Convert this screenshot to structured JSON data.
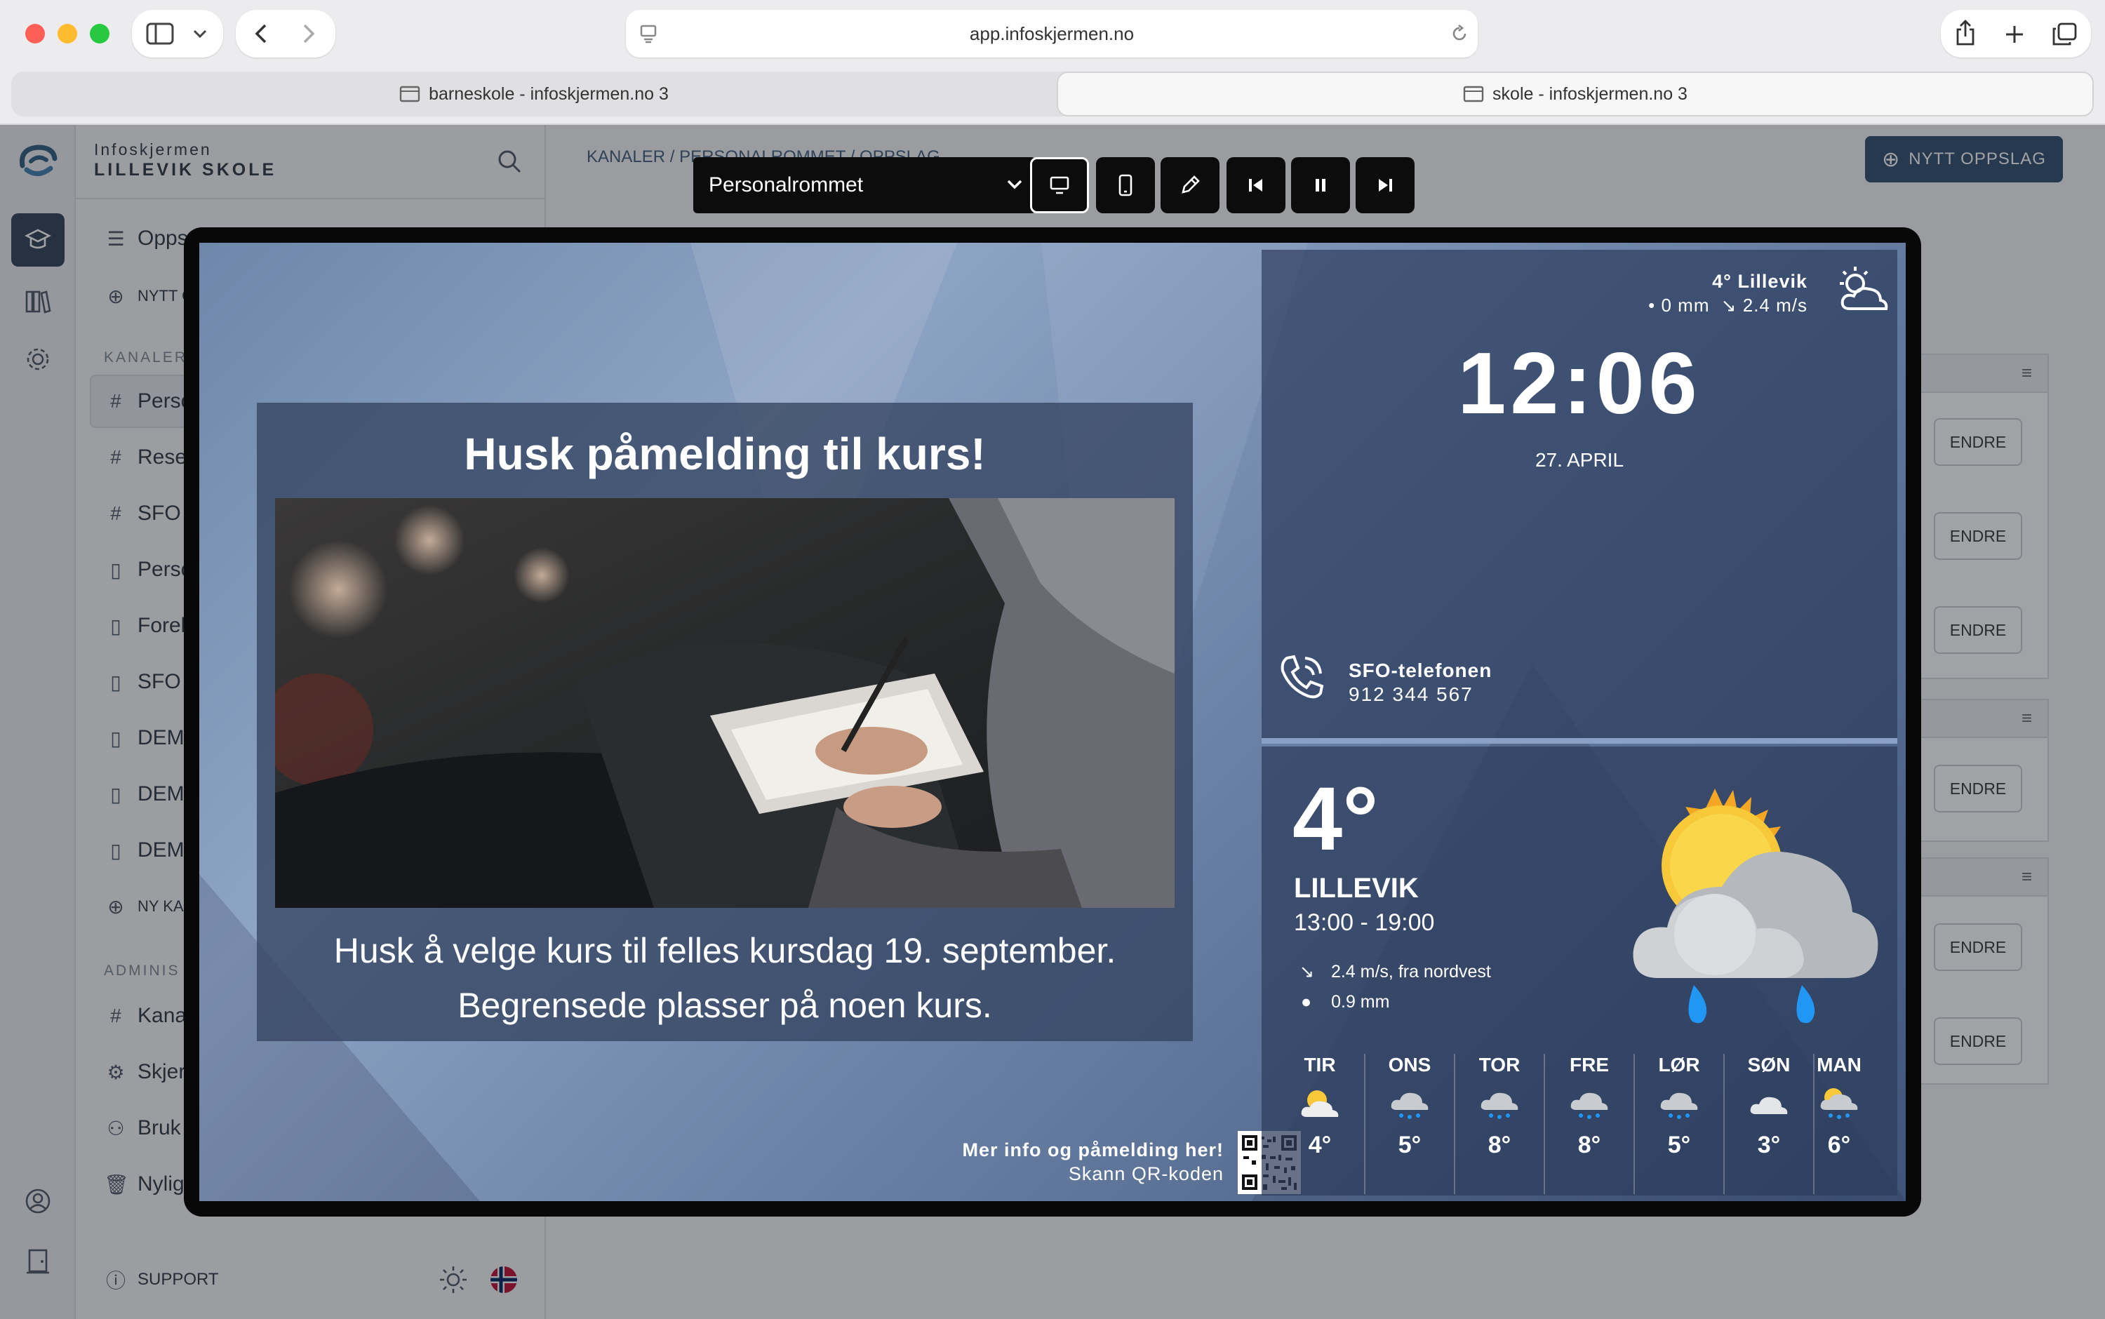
{
  "browser": {
    "url": "app.infoskjermen.no",
    "tabs": [
      {
        "label": "barneskole - infoskjermen.no 3"
      },
      {
        "label": "skole - infoskjermen.no 3"
      }
    ]
  },
  "brand": {
    "line1": "Infoskjermen",
    "line2": "LILLEVIK SKOLE"
  },
  "sidebar": {
    "items_top": [
      {
        "label": "Opps",
        "icon": "list-icon"
      },
      {
        "label": "NYTT O",
        "icon": "plus-circle-icon"
      }
    ],
    "section_kanaler": "KANALER",
    "kanaler": [
      {
        "label": "Perso",
        "icon": "hash-icon"
      },
      {
        "label": "Rese",
        "icon": "hash-icon"
      },
      {
        "label": "SFO",
        "icon": "hash-icon"
      },
      {
        "label": "Perso",
        "icon": "phone-icon"
      },
      {
        "label": "Forel",
        "icon": "phone-icon"
      },
      {
        "label": "SFO",
        "icon": "phone-icon"
      },
      {
        "label": "DEM",
        "icon": "phone-icon"
      },
      {
        "label": "DEM",
        "icon": "phone-icon"
      },
      {
        "label": "DEM",
        "icon": "phone-icon"
      },
      {
        "label": "NY KA",
        "icon": "plus-circle-icon"
      }
    ],
    "section_admin": "ADMINIS",
    "admin": [
      {
        "label": "Kana",
        "icon": "hash-icon"
      },
      {
        "label": "Skjer",
        "icon": "gear-icon"
      },
      {
        "label": "Bruk",
        "icon": "users-icon"
      },
      {
        "label": "Nylig",
        "icon": "trash-icon"
      }
    ],
    "support": "SUPPORT"
  },
  "main": {
    "breadcrumb": [
      "KANALER",
      "PERSONALROMMET",
      "OPPSLAG"
    ],
    "new_post": "NYTT OPPSLAG",
    "endre": "ENDRE"
  },
  "preview": {
    "channel_select": "Personalrommet",
    "poster": {
      "title": "Husk påmelding til kurs!",
      "body_line1": "Husk å velge kurs til felles kursdag 19. september.",
      "body_line2": "Begrensede plasser på noen kurs.",
      "qr_line1": "Mer info og påmelding her!",
      "qr_line2": "Skann QR-koden"
    },
    "weather_top": {
      "temp_place": "4° Lillevik",
      "rain": "0 mm",
      "wind": "2.4 m/s"
    },
    "clock": {
      "time": "12:06",
      "date": "27. APRIL"
    },
    "phone": {
      "label": "SFO-telefonen",
      "number": "912 344 567"
    },
    "forecast_now": {
      "temp": "4°",
      "place": "LILLEVIK",
      "interval": "13:00 - 19:00",
      "wind": "2.4 m/s, fra nordvest",
      "rain": "0.9 mm"
    },
    "days": [
      {
        "day": "TIR",
        "temp": "4°",
        "icon": "sun-cloud-icon"
      },
      {
        "day": "ONS",
        "temp": "5°",
        "icon": "rain-cloud-icon"
      },
      {
        "day": "TOR",
        "temp": "8°",
        "icon": "rain-cloud-icon"
      },
      {
        "day": "FRE",
        "temp": "8°",
        "icon": "rain-cloud-icon"
      },
      {
        "day": "LØR",
        "temp": "5°",
        "icon": "rain-cloud-icon"
      },
      {
        "day": "SØN",
        "temp": "3°",
        "icon": "cloud-icon"
      },
      {
        "day": "MAN",
        "temp": "6°",
        "icon": "sun-rain-icon"
      }
    ]
  }
}
